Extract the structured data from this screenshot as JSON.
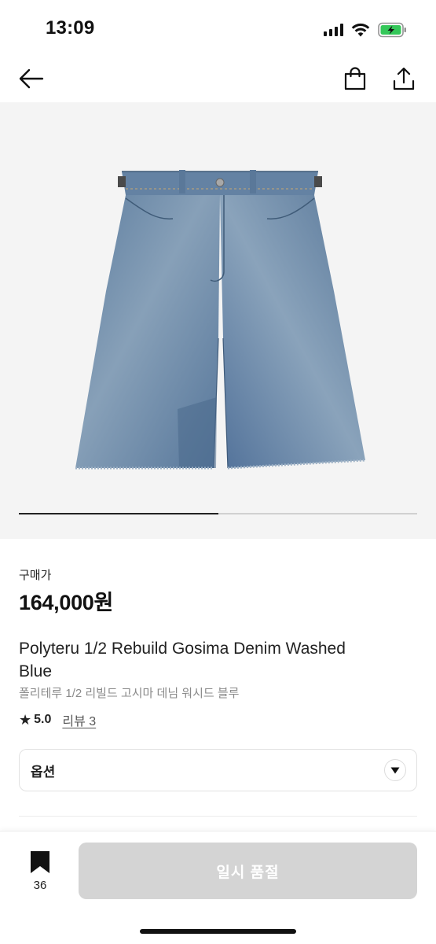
{
  "status_bar": {
    "time": "13:09"
  },
  "nav": {
    "back_icon": "arrow-left-icon",
    "bag_icon": "shopping-bag-icon",
    "share_icon": "share-icon"
  },
  "gallery": {
    "image": "washed-blue-denim-shorts",
    "progress": 0.5
  },
  "product": {
    "price_label": "구매가",
    "price": "164,000원",
    "name_en": "Polyteru 1/2 Rebuild Gosima Denim Washed Blue",
    "name_ko": "폴리테루 1/2 리빌드 고시마 데님 워시드 블루",
    "rating_star": "★",
    "rating": "5.0",
    "review_link": "리뷰 3"
  },
  "options": {
    "label": "옵션",
    "arrow_icon": "triangle-down-icon"
  },
  "bottom_bar": {
    "bookmark_icon": "bookmark-icon",
    "wish_count": "36",
    "soldout_label": "일시 품절"
  },
  "colors": {
    "accent": "#111111",
    "soldout_bg": "#d4d4d4",
    "battery_green": "#34c759",
    "denim": "#5c7a9a"
  }
}
